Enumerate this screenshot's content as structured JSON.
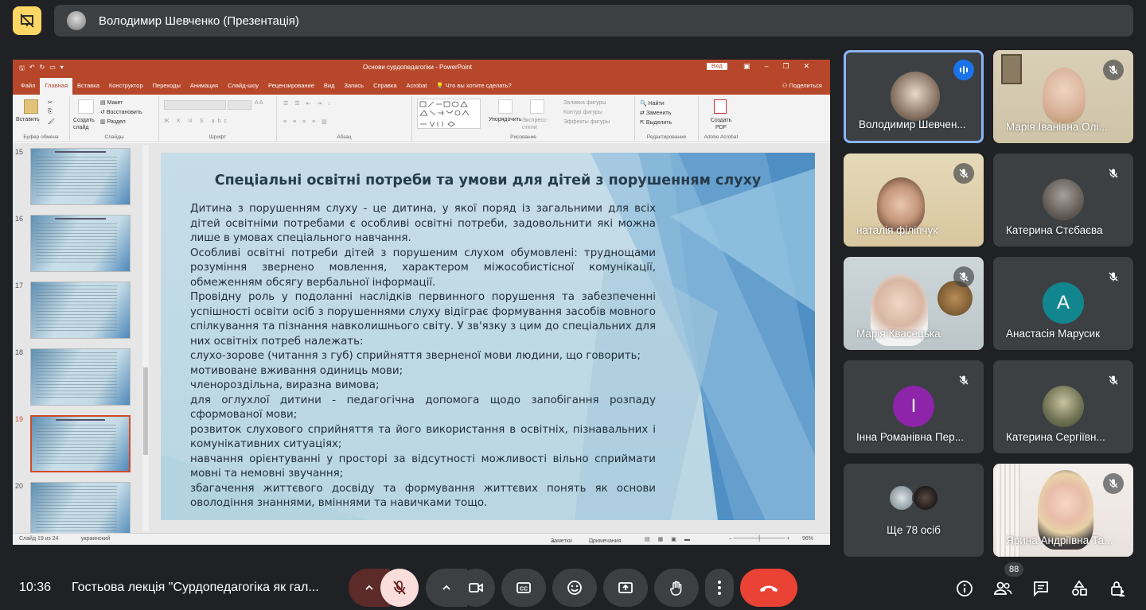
{
  "meet": {
    "presenter_label": "Володимир Шевченко (Презентація)",
    "clock": "10:36",
    "meeting_title": "Гостьова лекція \"Сурдопедагогіка як гал...",
    "participant_count": "88",
    "accent_red": "#ea4335",
    "present_yellow": "#fdd663"
  },
  "powerpoint": {
    "window_title": "Основи сурдопедагогіки  -  PowerPoint",
    "sign_in": "Вхід",
    "tabs": [
      "Файл",
      "Главная",
      "Вставка",
      "Конструктор",
      "Переходы",
      "Анимация",
      "Слайд-шоу",
      "Рецензирование",
      "Вид",
      "Запись",
      "Справка",
      "Acrobat"
    ],
    "active_tab": "Главная",
    "tell_me": "Что вы хотите сделать?",
    "share": "Поделиться",
    "ribbon": {
      "paste": "Вставить",
      "clipboard": "Буфер обмена",
      "create_slide": "Создать слайд",
      "layout": "Макет",
      "reset": "Восстановить",
      "section": "Раздел",
      "slides": "Слайды",
      "font": "Шрифт",
      "paragraph": "Абзац",
      "arrange": "Упорядочить",
      "quick_styles": "Экспресс-стили",
      "shape_fill": "Заливка фигуры",
      "shape_outline": "Контур фигуры",
      "shape_effects": "Эффекты фигуры",
      "drawing": "Рисование",
      "find": "Найти",
      "replace": "Заменить",
      "select": "Выделить",
      "editing": "Редактирование",
      "create_pdf": "Создать PDF",
      "adobe": "Adobe Acrobat"
    },
    "thumb_numbers": [
      "15",
      "16",
      "17",
      "18",
      "19",
      "20"
    ],
    "selected_thumb": "19",
    "status": {
      "slide_of": "Слайд 19 из 24",
      "language": "украинский",
      "notes": "Заметки",
      "comments": "Примечания",
      "zoom": "96%"
    }
  },
  "slide": {
    "title": "Спеціальні освітні потреби та умови для дітей з порушенням слуху",
    "paragraphs": [
      "Дитина з порушенням слуху - це дитина, у якої поряд із загальними для всіх дітей освітніми потребами є особливі освітні потреби, задовольнити які можна лише в умовах спеціального навчання.",
      "Особливі освітні потреби дітей з порушеним слухом обумовлені: труднощами розуміння звернено мовлення, характером міжособистісної комунікації, обмеженням обсягу вербальної інформації.",
      "Провідну роль у подоланні наслідків первинного порушення та забезпеченні успішності освіти осіб з порушеннями слуху відіграє формування засобів мовного спілкування та пізнання навколишнього світу. У зв'язку з цим до спеціальних для них освітніх потреб належать:",
      "слухо-зорове (читання з губ) сприйняття зверненої мови людини, що говорить;",
      "мотивоване вживання одиниць мови;",
      "членороздільна, виразна вимова;",
      "для оглухлої дитини - педагогічна допомога щодо запобігання розпаду сформованої мови;",
      "розвиток слухового сприйняття та його використання в освітніх, пізнавальних і комунікативних ситуаціях;",
      "навчання орієнтуванні у просторі за відсутності можливості вільно сприймати мовні та немовні звучання;",
      "збагачення життєвого досвіду та формування життєвих понять як основи оволодіння знаннями, вміннями та навичками тощо."
    ]
  },
  "participants": [
    {
      "name": "Володимир Шевчен...",
      "speaking": true
    },
    {
      "name": "Марія Іванівна Олі..."
    },
    {
      "name": "наталія філіпчук"
    },
    {
      "name": "Катерина Стєбаєва"
    },
    {
      "name": "Марія Квасецька"
    },
    {
      "name": "Анастасія Марусик",
      "initial": "А",
      "color": "#12868f"
    },
    {
      "name": "Інна Романівна Пер...",
      "initial": "І",
      "color": "#8e24aa"
    },
    {
      "name": "Катерина Сергіївн..."
    },
    {
      "name": "Ще 78 осіб"
    },
    {
      "name": "Ярина Андріївна Та..."
    }
  ]
}
